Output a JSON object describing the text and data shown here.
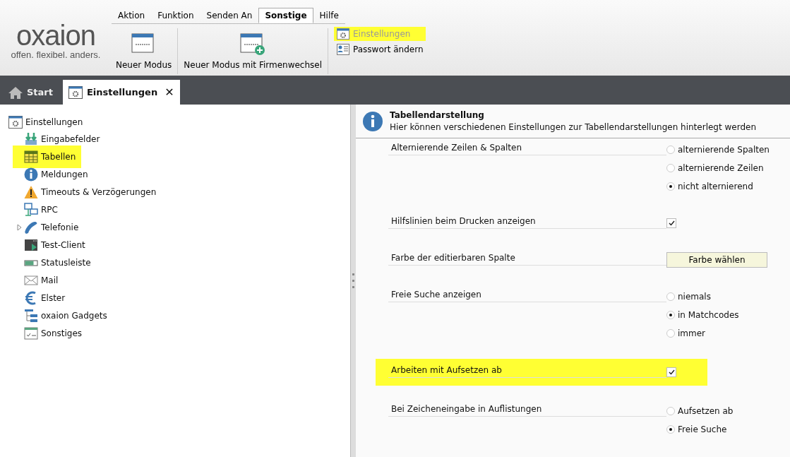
{
  "logo": {
    "name": "oxaion",
    "tagline": "offen. flexibel. anders."
  },
  "menu_tabs": [
    {
      "label": "Aktion",
      "selected": false
    },
    {
      "label": "Funktion",
      "selected": false
    },
    {
      "label": "Senden An",
      "selected": false
    },
    {
      "label": "Sonstige",
      "selected": true
    },
    {
      "label": "Hilfe",
      "selected": false
    }
  ],
  "ribbon": {
    "large_buttons": [
      {
        "label": "Neuer Modus",
        "kind": "window"
      },
      {
        "label": "Neuer Modus mit Firmenwechsel",
        "kind": "window-plus"
      }
    ],
    "small_buttons": [
      {
        "label": "Einstellungen",
        "kind": "settings",
        "disabled": true,
        "highlighted": true
      },
      {
        "label": "Passwort ändern",
        "kind": "user-card",
        "disabled": false,
        "highlighted": false
      }
    ]
  },
  "doc_tabs": [
    {
      "label": "Start",
      "kind": "home",
      "selected": false
    },
    {
      "label": "Einstellungen",
      "kind": "settings",
      "selected": true,
      "close": "✕"
    }
  ],
  "tree": {
    "label": "Einstellungen",
    "kind": "settings",
    "children": [
      {
        "label": "Eingabefelder",
        "kind": "download",
        "highlighted": false,
        "expandable": false
      },
      {
        "label": "Tabellen",
        "kind": "table",
        "highlighted": true,
        "expandable": false
      },
      {
        "label": "Meldungen",
        "kind": "info",
        "highlighted": false,
        "expandable": false
      },
      {
        "label": "Timeouts & Verzögerungen",
        "kind": "warning",
        "highlighted": false,
        "expandable": false
      },
      {
        "label": "RPC",
        "kind": "network",
        "highlighted": false,
        "expandable": false
      },
      {
        "label": "Telefonie",
        "kind": "phone",
        "highlighted": false,
        "expandable": true
      },
      {
        "label": "Test-Client",
        "kind": "console",
        "highlighted": false,
        "expandable": false
      },
      {
        "label": "Statusleiste",
        "kind": "statusbar",
        "highlighted": false,
        "expandable": false
      },
      {
        "label": "Mail",
        "kind": "mail",
        "highlighted": false,
        "expandable": false
      },
      {
        "label": "Elster",
        "kind": "euro",
        "highlighted": false,
        "expandable": false
      },
      {
        "label": "oxaion Gadgets",
        "kind": "gadgets",
        "highlighted": false,
        "expandable": false
      },
      {
        "label": "Sonstiges",
        "kind": "form",
        "highlighted": false,
        "expandable": false
      }
    ]
  },
  "panel": {
    "title": "Tabellendarstellung",
    "description": "Hier können verschiedenen Einstellungen zur Tabellendarstellungen hinterlegt werden",
    "settings": [
      {
        "label": "Alternierende Zeilen & Spalten",
        "kind": "radio",
        "highlighted": false,
        "options": [
          {
            "label": "alternierende Spalten",
            "selected": false
          },
          {
            "label": "alternierende Zeilen",
            "selected": false
          },
          {
            "label": "nicht alternierend",
            "selected": true
          }
        ]
      },
      {
        "label": "Hilfslinien beim Drucken anzeigen",
        "kind": "checkbox",
        "highlighted": false,
        "checked": true
      },
      {
        "label": "Farbe der editierbaren Spalte",
        "kind": "button",
        "highlighted": false,
        "button": "Farbe wählen"
      },
      {
        "label": "Freie Suche anzeigen",
        "kind": "radio",
        "highlighted": false,
        "options": [
          {
            "label": "niemals",
            "selected": false
          },
          {
            "label": "in Matchcodes",
            "selected": true
          },
          {
            "label": "immer",
            "selected": false
          }
        ]
      },
      {
        "label": "Arbeiten mit Aufsetzen ab",
        "kind": "checkbox",
        "highlighted": true,
        "checked": true
      },
      {
        "label": "Bei Zeicheneingabe in Auflistungen",
        "kind": "radio",
        "highlighted": false,
        "options": [
          {
            "label": "Aufsetzen ab",
            "selected": false
          },
          {
            "label": "Freie Suche",
            "selected": true
          }
        ]
      }
    ]
  }
}
